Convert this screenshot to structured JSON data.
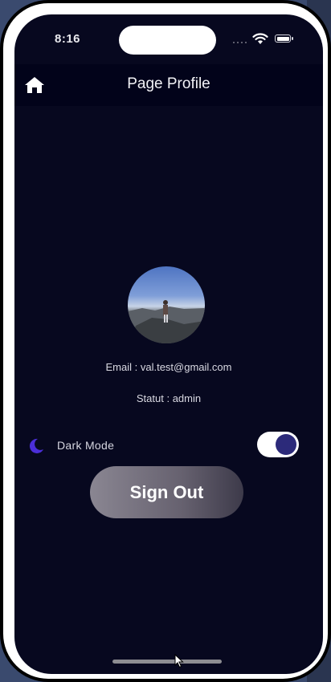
{
  "status_bar": {
    "time": "8:16"
  },
  "app_bar": {
    "title": "Page Profile"
  },
  "profile": {
    "email_text": "Email : val.test@gmail.com",
    "statut_text": "Statut : admin"
  },
  "settings": {
    "dark_mode_label": "Dark Mode",
    "dark_mode_on": true
  },
  "actions": {
    "sign_out_label": "Sign Out"
  },
  "colors": {
    "background": "#07081f",
    "app_bar": "#02031a",
    "toggle_knob": "#2c2a7a",
    "moon_icon": "#4b2ed8"
  },
  "icons": [
    "home-icon",
    "moon-icon",
    "wifi-icon",
    "battery-icon",
    "signal-icon"
  ]
}
